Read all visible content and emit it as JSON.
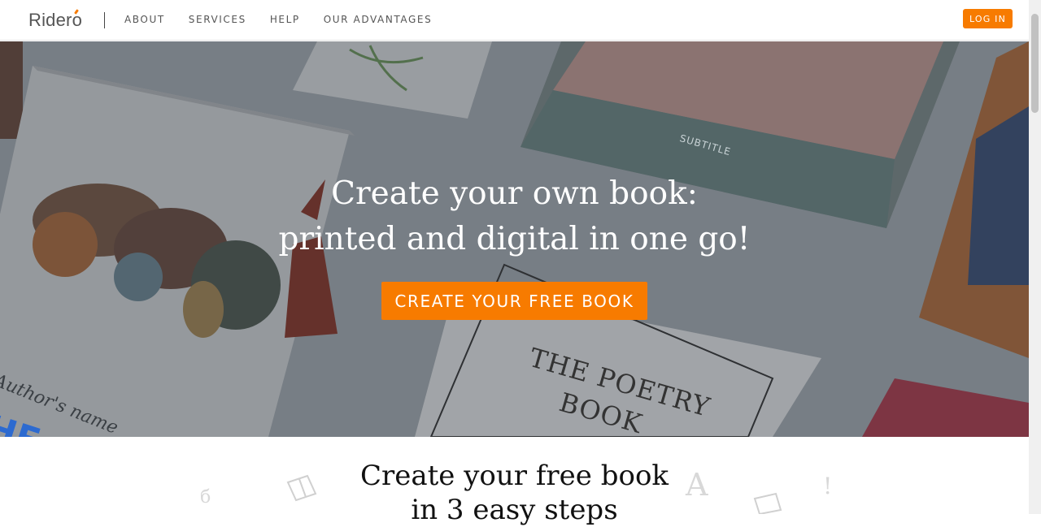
{
  "header": {
    "logo": "Ridero",
    "nav": [
      "ABOUT",
      "SERVICES",
      "HELP",
      "OUR ADVANTAGES"
    ],
    "login_label": "LOG IN"
  },
  "hero": {
    "title_line1": "Create your own book:",
    "title_line2": "printed and digital in one go!",
    "cta_label": "CREATE YOUR FREE BOOK",
    "image_text": {
      "author": "Author's name",
      "poetry_title_1": "THE POETRY",
      "poetry_title_2": "BOOK",
      "subtitle": "SUBTITLE",
      "book_title_fragment": "HE GO"
    }
  },
  "steps": {
    "title_line1": "Create your free book",
    "title_line2": "in 3 easy steps"
  },
  "colors": {
    "accent": "#f77b00",
    "nav_text": "#555555"
  }
}
